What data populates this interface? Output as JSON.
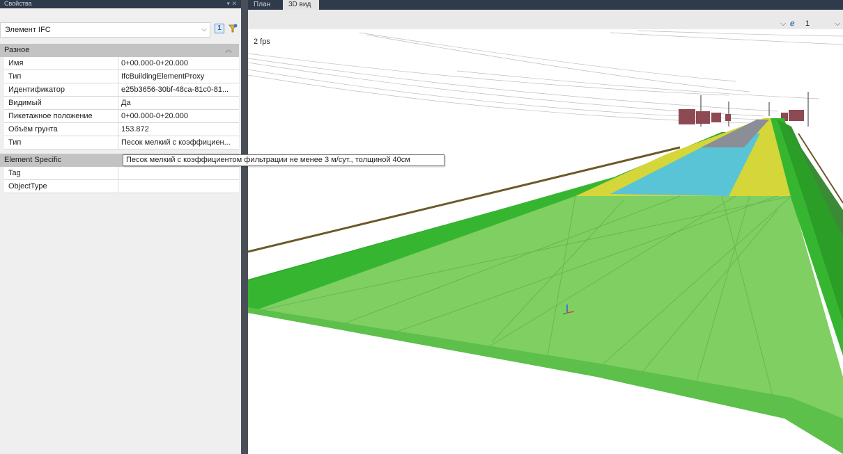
{
  "panel": {
    "title": "Свойства",
    "element_type": "Элемент IFC",
    "sections": [
      {
        "title": "Разное",
        "rows": [
          {
            "key": "Имя",
            "value": "0+00.000-0+20.000"
          },
          {
            "key": "Тип",
            "value": "IfcBuildingElementProxy"
          },
          {
            "key": "Идентификатор",
            "value": "e25b3656-30bf-48ca-81c0-81..."
          },
          {
            "key": "Видимый",
            "value": "Да"
          },
          {
            "key": "Пикетажное положение",
            "value": "0+00.000-0+20.000"
          },
          {
            "key": "Объём грунта",
            "value": "153.872"
          },
          {
            "key": "Тип",
            "value": "Песок мелкий с коэффициен..."
          }
        ]
      },
      {
        "title": "Element Specific",
        "rows": [
          {
            "key": "Tag",
            "value": ""
          },
          {
            "key": "ObjectType",
            "value": ""
          }
        ]
      }
    ]
  },
  "tabs": {
    "plan": "План",
    "view3d": "3D вид"
  },
  "view": {
    "fps": "2 fps",
    "camera_value": "1"
  },
  "tooltip": {
    "text": "Песок мелкий с коэффициентом фильтрации не менее 3 м/сут., толщиной 40см"
  },
  "colors": {
    "outer_green": "#3fc43a",
    "slope_green": "#7fcf63",
    "yellow": "#d4d63a",
    "cyan": "#58c4d6",
    "asphalt": "#8b8e96",
    "building": "#8e4a52"
  },
  "icons": {
    "dropdown": "chevron-down-icon",
    "collapse": "double-chevron-up-icon",
    "filter": "quick-properties-icon",
    "camera": "camera-icon"
  }
}
